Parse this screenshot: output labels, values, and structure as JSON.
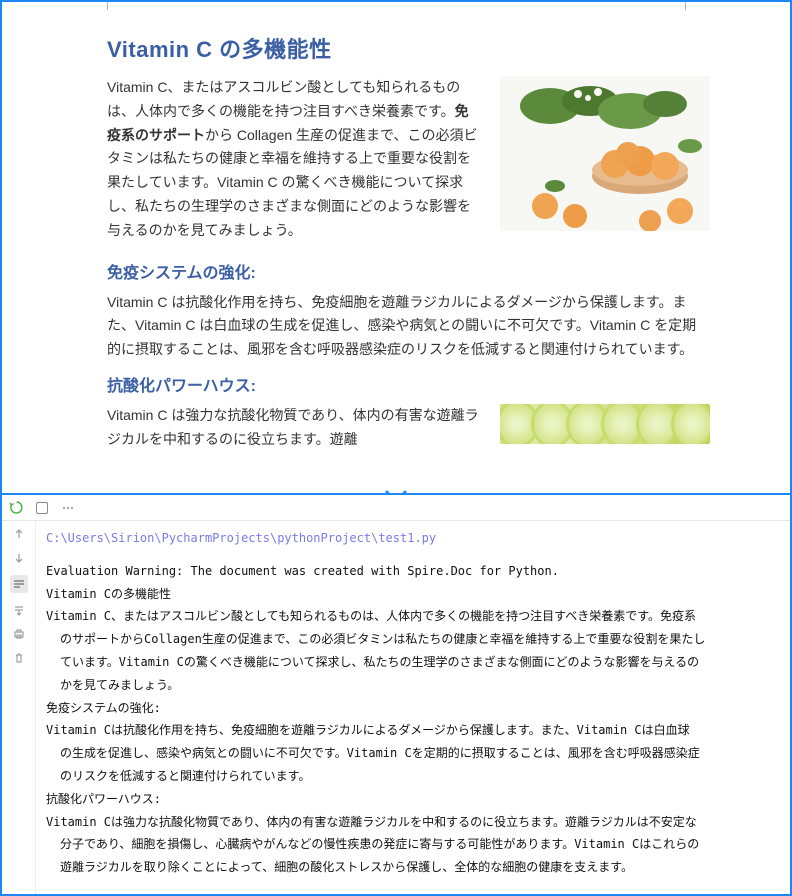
{
  "document": {
    "title": "Vitamin C の多機能性",
    "section1": {
      "para": "Vitamin C、またはアスコルビン酸としても知られるものは、人体内で多くの機能を持つ注目すべき栄養素です。",
      "bold": "免疫系のサポート",
      "para2": "から Collagen 生産の促進まで、この必須ビタミンは私たちの健康と幸福を維持する上で重要な役割を果たしています。Vitamin C の驚くべき機能について探求し、私たちの生理学のさまざまな側面にどのような影響を与えるのかを見てみましょう。"
    },
    "section2": {
      "heading": "免疫システムの強化:",
      "para": "Vitamin C は抗酸化作用を持ち、免疫細胞を遊離ラジカルによるダメージから保護します。また、Vitamin C は白血球の生成を促進し、感染や病気との闘いに不可欠です。Vitamin C を定期的に摂取することは、風邪を含む呼吸器感染症のリスクを低減すると関連付けられています。"
    },
    "section3": {
      "heading": "抗酸化パワーハウス:",
      "para": "Vitamin C は強力な抗酸化物質であり、体内の有害な遊離ラジカルを中和するのに役立ちます。遊離"
    }
  },
  "console": {
    "path": "C:\\Users\\Sirion\\PycharmProjects\\pythonProject\\test1.py",
    "lines": [
      {
        "t": "Evaluation Warning: The document was created with Spire.Doc for Python.",
        "i": false
      },
      {
        "t": "Vitamin Cの多機能性",
        "i": false
      },
      {
        "t": "Vitamin C、またはアスコルビン酸としても知られるものは、人体内で多くの機能を持つ注目すべき栄養素です。免疫系",
        "i": false
      },
      {
        "t": "のサポートからCollagen生産の促進まで、この必須ビタミンは私たちの健康と幸福を維持する上で重要な役割を果たし",
        "i": true
      },
      {
        "t": "ています。Vitamin Cの驚くべき機能について探求し、私たちの生理学のさまざまな側面にどのような影響を与えるの",
        "i": true
      },
      {
        "t": "かを見てみましょう。",
        "i": true
      },
      {
        "t": "免疫システムの強化:",
        "i": false
      },
      {
        "t": "Vitamin Cは抗酸化作用を持ち、免疫細胞を遊離ラジカルによるダメージから保護します。また、Vitamin Cは白血球",
        "i": false
      },
      {
        "t": "の生成を促進し、感染や病気との闘いに不可欠です。Vitamin Cを定期的に摂取することは、風邪を含む呼吸器感染症",
        "i": true
      },
      {
        "t": "のリスクを低減すると関連付けられています。",
        "i": true
      },
      {
        "t": "抗酸化パワーハウス:",
        "i": false
      },
      {
        "t": "Vitamin Cは強力な抗酸化物質であり、体内の有害な遊離ラジカルを中和するのに役立ちます。遊離ラジカルは不安定な",
        "i": false
      },
      {
        "t": "分子であり、細胞を損傷し、心臓病やがんなどの慢性疾患の発症に寄与する可能性があります。Vitamin Cはこれらの",
        "i": true
      },
      {
        "t": "遊離ラジカルを取り除くことによって、細胞の酸化ストレスから保護し、全体的な細胞の健康を支えます。",
        "i": true
      }
    ]
  }
}
